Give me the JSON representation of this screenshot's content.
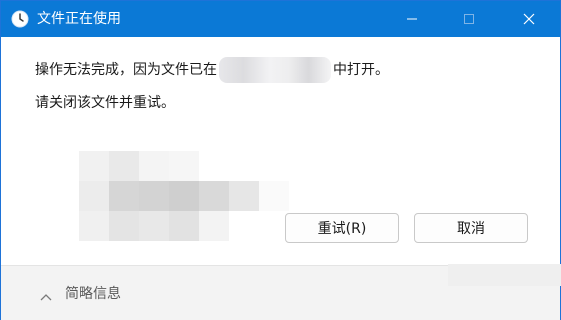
{
  "window": {
    "title": "文件正在使用",
    "app_icon": "clock-icon",
    "controls": {
      "minimize": "minimize-icon",
      "maximize": "maximize-icon",
      "close": "close-icon"
    }
  },
  "message": {
    "line1_prefix": "操作无法完成，因为文件已在",
    "line1_suffix": "中打开。",
    "line2": "请关闭该文件并重试。"
  },
  "buttons": {
    "retry": "重试(R)",
    "cancel": "取消"
  },
  "footer": {
    "details_label": "简略信息",
    "toggle_icon": "chevron-up-icon"
  },
  "colors": {
    "titlebar": "#0b79d6",
    "title_text": "#ffffff",
    "footer_bg": "#f3f3f3"
  }
}
